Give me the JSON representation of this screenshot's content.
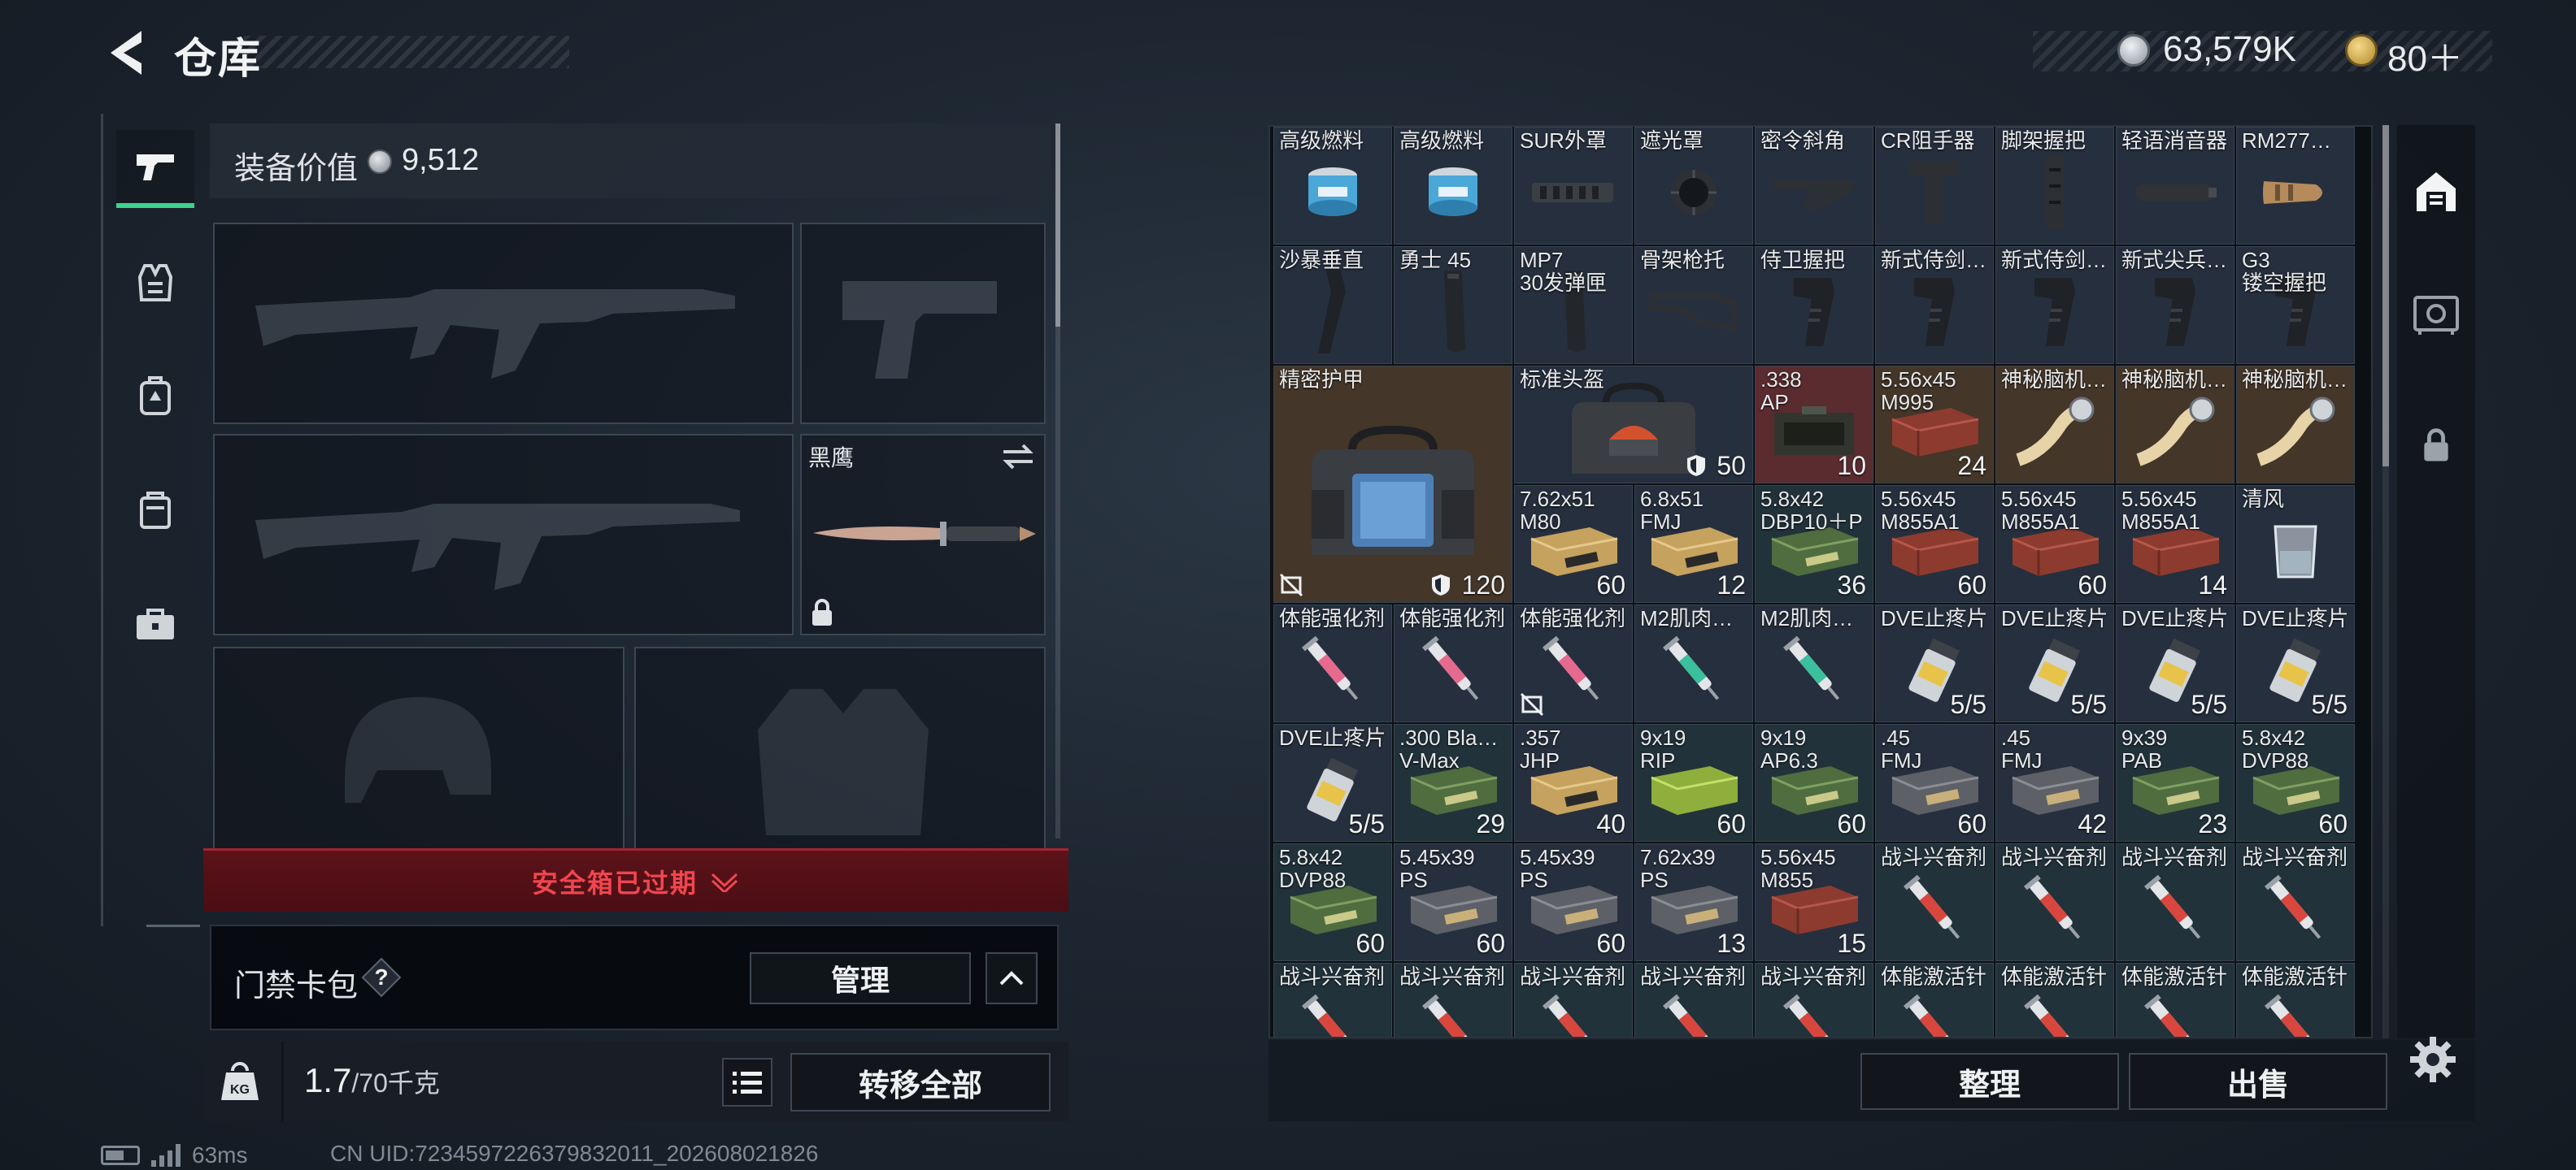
{
  "header": {
    "title": "仓库",
    "currency1": "63,579K",
    "currency2": "80＋"
  },
  "left_nav": {
    "items": [
      "pistol-icon",
      "vest-icon",
      "backpack-icon",
      "pouch-icon",
      "toolbox-icon"
    ],
    "active_index": 0
  },
  "equipment": {
    "value_label": "装备价值",
    "value": "9,512",
    "melee_name": "黑鹰",
    "safe_box_text": "安全箱已过期",
    "card_pack_label": "门禁卡包",
    "help": "?",
    "manage_label": "管理",
    "weight_current": "1.7",
    "weight_max": "/70千克",
    "transfer_all_label": "转移全部"
  },
  "grid": {
    "cells": [
      {
        "name": "高级燃料",
        "count": "",
        "color": "#262f3d",
        "icon": "can-icon"
      },
      {
        "name": "高级燃料",
        "count": "",
        "color": "#262f3d",
        "icon": "can-icon"
      },
      {
        "name": "SUR外罩",
        "count": "",
        "color": "#262f3d",
        "icon": "shroud-icon"
      },
      {
        "name": "遮光罩",
        "count": "",
        "color": "#262f3d",
        "icon": "flash-hider-icon"
      },
      {
        "name": "密令斜角",
        "count": "",
        "color": "#262f3d",
        "icon": "angled-grip-icon"
      },
      {
        "name": "CR阻手器",
        "count": "",
        "color": "#262f3d",
        "icon": "handstop-icon"
      },
      {
        "name": "脚架握把",
        "count": "",
        "color": "#262f3d",
        "icon": "bipod-grip-icon"
      },
      {
        "name": "轻语消音器",
        "count": "",
        "color": "#262f3d",
        "icon": "suppressor-icon"
      },
      {
        "name": "RM277…",
        "count": "",
        "color": "#262f3d",
        "icon": "muzzle-brake-icon"
      },
      {
        "name": "沙暴垂直",
        "count": "",
        "color": "#262f3d",
        "icon": "vertical-grip-icon"
      },
      {
        "name": "勇士 45",
        "count": "",
        "color": "#262f3d",
        "icon": "magazine-icon"
      },
      {
        "name": "MP7\n30发弹匣",
        "count": "",
        "color": "#262f3d",
        "icon": "magazine-icon"
      },
      {
        "name": "骨架枪托",
        "count": "",
        "color": "#262f3d",
        "icon": "stock-icon"
      },
      {
        "name": "侍卫握把",
        "count": "",
        "color": "#262f3d",
        "icon": "pistol-grip-icon"
      },
      {
        "name": "新式侍剑…",
        "count": "",
        "color": "#262f3d",
        "icon": "pistol-grip-icon"
      },
      {
        "name": "新式侍剑…",
        "count": "",
        "color": "#262f3d",
        "icon": "pistol-grip-icon"
      },
      {
        "name": "新式尖兵…",
        "count": "",
        "color": "#262f3d",
        "icon": "pistol-grip-icon"
      },
      {
        "name": "G3\n镂空握把",
        "count": "",
        "color": "#262f3d",
        "icon": "pistol-grip-icon"
      },
      {
        "name": "精密护甲",
        "count": "120",
        "color": "#443628",
        "icon": "armor-bag-icon"
      },
      {
        "name": "标准头盔",
        "count": "50",
        "color": "#262f3d",
        "icon": "helmet-bag-icon"
      },
      {
        "name": ".338\nAP",
        "count": "10",
        "color": "#5a2b2f",
        "icon": "ammo-crate-icon"
      },
      {
        "name": "5.56x45\nM995",
        "count": "24",
        "color": "#443628",
        "icon": "ammo-box-red-icon"
      },
      {
        "name": "神秘脑机…",
        "count": "",
        "color": "#443628",
        "icon": "chip-tape-icon"
      },
      {
        "name": "神秘脑机…",
        "count": "",
        "color": "#443628",
        "icon": "chip-tape-icon"
      },
      {
        "name": "神秘脑机…",
        "count": "",
        "color": "#443628",
        "icon": "chip-tape-icon"
      },
      {
        "name": "7.62x51\nM80",
        "count": "60",
        "color": "#262f3d",
        "icon": "ammo-box-tan-icon"
      },
      {
        "name": "6.8x51\nFMJ",
        "count": "12",
        "color": "#262f3d",
        "icon": "ammo-box-tan-icon"
      },
      {
        "name": "5.8x42\nDBP10＋P",
        "count": "36",
        "color": "#22323a",
        "icon": "ammo-box-green-icon"
      },
      {
        "name": "5.56x45\nM855A1",
        "count": "60",
        "color": "#262f3d",
        "icon": "ammo-box-red-icon"
      },
      {
        "name": "5.56x45\nM855A1",
        "count": "60",
        "color": "#262f3d",
        "icon": "ammo-box-red-icon"
      },
      {
        "name": "5.56x45\nM855A1",
        "count": "14",
        "color": "#262f3d",
        "icon": "ammo-box-red-icon"
      },
      {
        "name": "清风",
        "count": "",
        "color": "#262f3d",
        "icon": "glass-icon"
      },
      {
        "name": "体能强化剂",
        "count": "",
        "color": "#262f3d",
        "icon": "syringe-pink-icon"
      },
      {
        "name": "体能强化剂",
        "count": "",
        "color": "#262f3d",
        "icon": "syringe-pink-icon"
      },
      {
        "name": "体能强化剂",
        "count": "",
        "color": "#262f3d",
        "icon": "syringe-pink-icon"
      },
      {
        "name": "M2肌肉…",
        "count": "",
        "color": "#262f3d",
        "icon": "syringe-teal-icon"
      },
      {
        "name": "M2肌肉…",
        "count": "",
        "color": "#262f3d",
        "icon": "syringe-teal-icon"
      },
      {
        "name": "DVE止疼片",
        "count": "5/5",
        "color": "#262f3d",
        "icon": "pill-bottle-icon"
      },
      {
        "name": "DVE止疼片",
        "count": "5/5",
        "color": "#262f3d",
        "icon": "pill-bottle-icon"
      },
      {
        "name": "DVE止疼片",
        "count": "5/5",
        "color": "#262f3d",
        "icon": "pill-bottle-icon"
      },
      {
        "name": "DVE止疼片",
        "count": "5/5",
        "color": "#262f3d",
        "icon": "pill-bottle-icon"
      },
      {
        "name": "DVE止疼片",
        "count": "5/5",
        "color": "#262f3d",
        "icon": "pill-bottle-icon"
      },
      {
        "name": ".300 Bla…\nV-Max",
        "count": "29",
        "color": "#22323a",
        "icon": "ammo-box-green-icon"
      },
      {
        "name": ".357\nJHP",
        "count": "40",
        "color": "#262f3d",
        "icon": "ammo-box-tan-icon"
      },
      {
        "name": "9x19\nRIP",
        "count": "60",
        "color": "#22323a",
        "icon": "ammo-box-lime-icon"
      },
      {
        "name": "9x19\nAP6.3",
        "count": "60",
        "color": "#22323a",
        "icon": "ammo-box-green-icon"
      },
      {
        "name": ".45\nFMJ",
        "count": "60",
        "color": "#262f3d",
        "icon": "ammo-box-grey-icon"
      },
      {
        "name": ".45\nFMJ",
        "count": "42",
        "color": "#262f3d",
        "icon": "ammo-box-grey-icon"
      },
      {
        "name": "9x39\nPAB",
        "count": "23",
        "color": "#22323a",
        "icon": "ammo-box-green-icon"
      },
      {
        "name": "5.8x42\nDVP88",
        "count": "60",
        "color": "#22323a",
        "icon": "ammo-box-green-icon"
      },
      {
        "name": "5.8x42\nDVP88",
        "count": "60",
        "color": "#22323a",
        "icon": "ammo-box-green-icon"
      },
      {
        "name": "5.45x39\nPS",
        "count": "60",
        "color": "#262f3d",
        "icon": "ammo-box-grey-icon"
      },
      {
        "name": "5.45x39\nPS",
        "count": "60",
        "color": "#262f3d",
        "icon": "ammo-box-grey-icon"
      },
      {
        "name": "7.62x39\nPS",
        "count": "13",
        "color": "#262f3d",
        "icon": "ammo-box-grey-icon"
      },
      {
        "name": "5.56x45\nM855",
        "count": "15",
        "color": "#262f3d",
        "icon": "ammo-box-red-icon"
      },
      {
        "name": "战斗兴奋剂",
        "count": "",
        "color": "#22323a",
        "icon": "syringe-red-icon"
      },
      {
        "name": "战斗兴奋剂",
        "count": "",
        "color": "#22323a",
        "icon": "syringe-red-icon"
      },
      {
        "name": "战斗兴奋剂",
        "count": "",
        "color": "#22323a",
        "icon": "syringe-red-icon"
      },
      {
        "name": "战斗兴奋剂",
        "count": "",
        "color": "#22323a",
        "icon": "syringe-red-icon"
      },
      {
        "name": "战斗兴奋剂",
        "count": "",
        "color": "#22323a",
        "icon": "syringe-red-icon"
      },
      {
        "name": "战斗兴奋剂",
        "count": "",
        "color": "#22323a",
        "icon": "syringe-red-icon"
      },
      {
        "name": "战斗兴奋剂",
        "count": "",
        "color": "#22323a",
        "icon": "syringe-red-icon"
      },
      {
        "name": "战斗兴奋剂",
        "count": "",
        "color": "#22323a",
        "icon": "syringe-red-icon"
      },
      {
        "name": "战斗兴奋剂",
        "count": "",
        "color": "#22323a",
        "icon": "syringe-red-icon"
      },
      {
        "name": "体能激活针",
        "count": "",
        "color": "#22323a",
        "icon": "syringe-red-icon"
      },
      {
        "name": "体能激活针",
        "count": "",
        "color": "#22323a",
        "icon": "syringe-red-icon"
      },
      {
        "name": "体能激活针",
        "count": "",
        "color": "#22323a",
        "icon": "syringe-red-icon"
      },
      {
        "name": "体能激活针",
        "count": "",
        "color": "#22323a",
        "icon": "syringe-red-icon"
      }
    ]
  },
  "side_right": {
    "icons": [
      "storage-icon",
      "vault-icon",
      "lock-icon"
    ]
  },
  "actions": {
    "sort_label": "整理",
    "sell_label": "出售"
  },
  "status": {
    "ping": "63ms",
    "uid": "CN UID:7234597226379832011_202608021826"
  }
}
